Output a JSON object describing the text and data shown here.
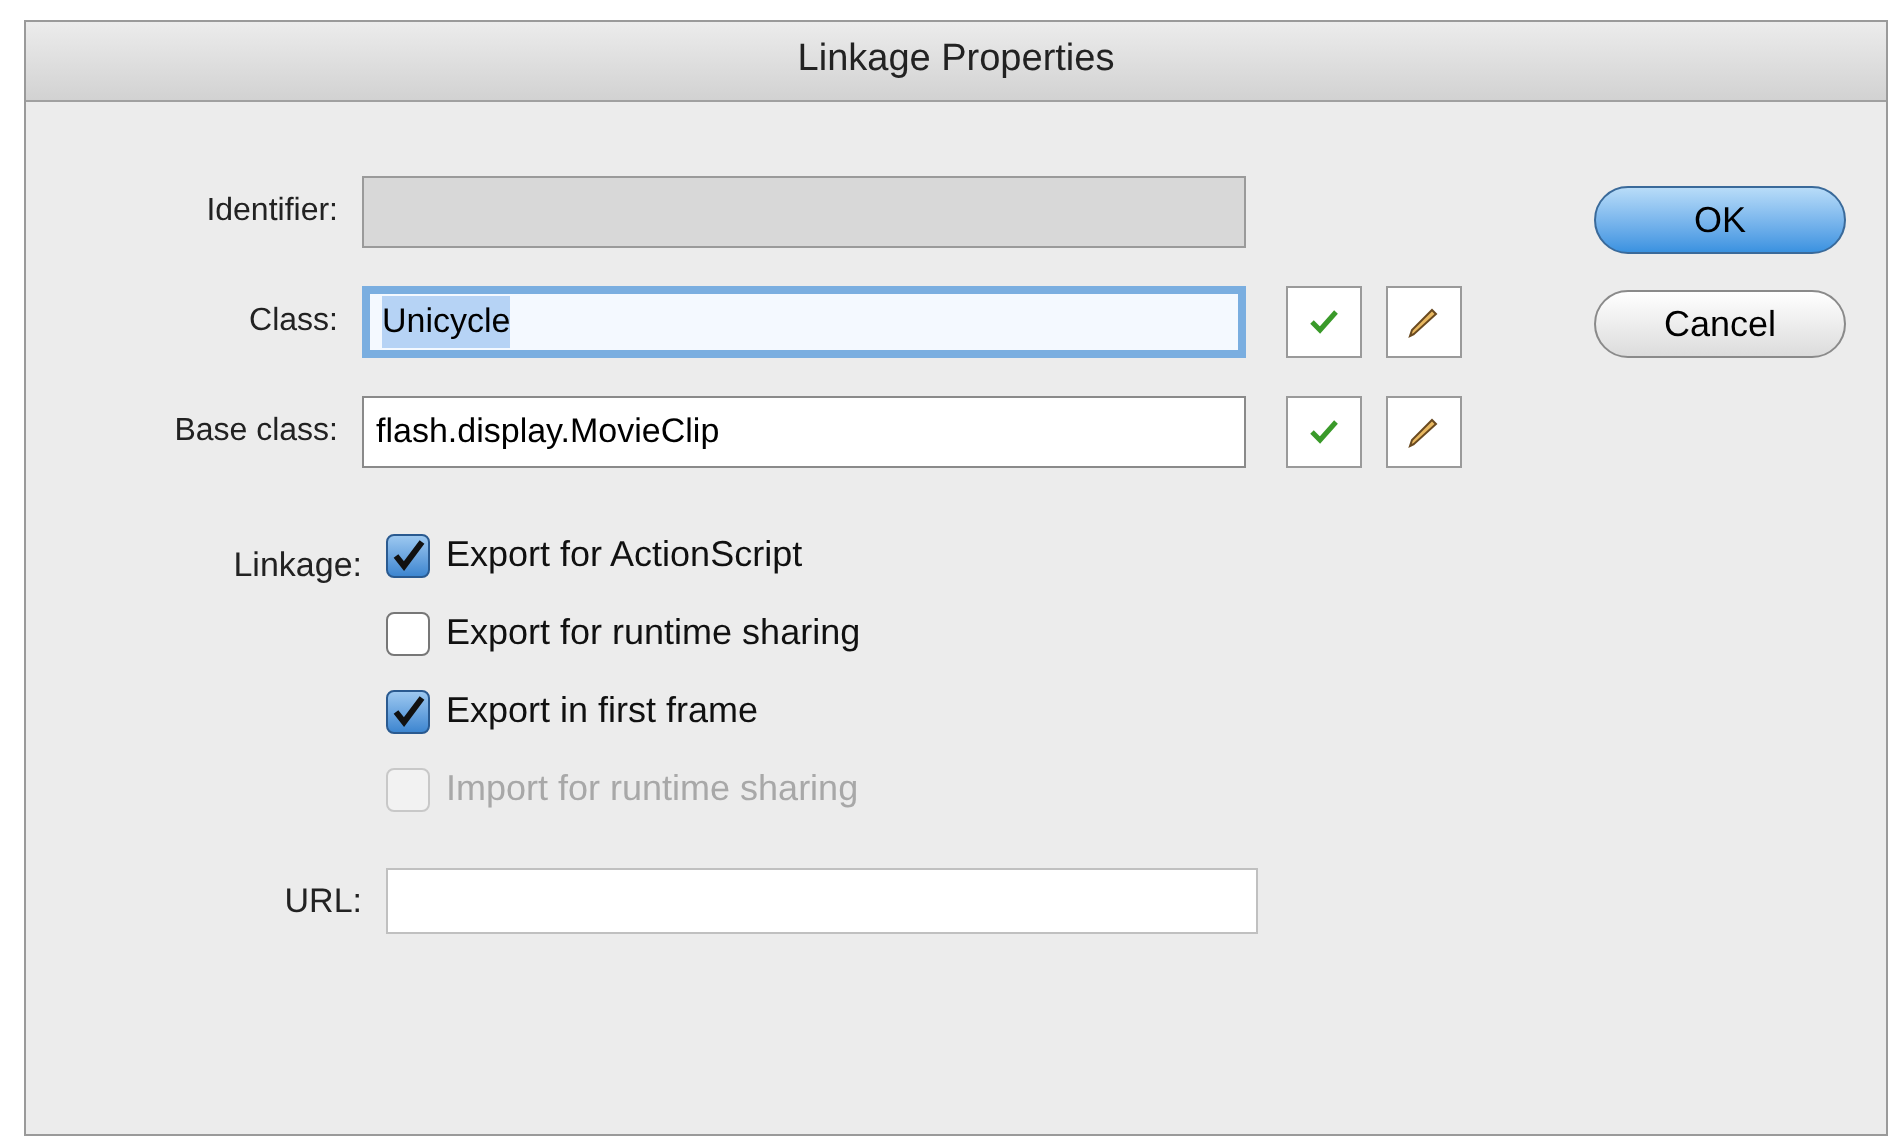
{
  "window": {
    "title": "Linkage Properties"
  },
  "fields": [
    {
      "label": "Identifier:",
      "disabled": true,
      "focused": false,
      "tools": false
    },
    {
      "label": "Class:",
      "value": "Unicycle",
      "disabled": false,
      "focused": true,
      "tools": true
    },
    {
      "label": "Base class:",
      "value": "flash.display.MovieClip",
      "disabled": false,
      "focused": false,
      "tools": true
    }
  ],
  "linkage": {
    "label": "Linkage:",
    "options": [
      {
        "label": "Export for ActionScript",
        "checked": true,
        "disabled": false
      },
      {
        "label": "Export for runtime sharing",
        "checked": false,
        "disabled": false
      },
      {
        "label": "Export in first frame",
        "checked": true,
        "disabled": false
      },
      {
        "label": "Import for runtime sharing",
        "checked": false,
        "disabled": true
      }
    ]
  },
  "url": {
    "label": "URL:"
  },
  "buttons": [
    {
      "label": "OK",
      "default": true
    },
    {
      "label": "Cancel",
      "default": false
    }
  ]
}
